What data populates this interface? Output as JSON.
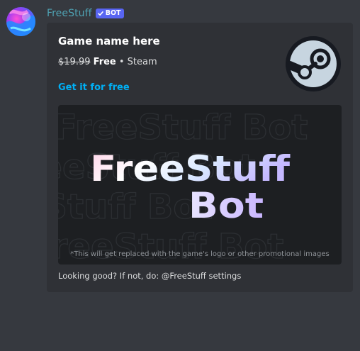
{
  "message": {
    "author": "FreeStuff",
    "bot_tag": "BOT"
  },
  "embed": {
    "title": "Game name here",
    "old_price": "$19.99",
    "price": "Free",
    "separator": " • ",
    "store": "Steam",
    "link_text": "Get it for free",
    "thumbnail_icon": "steam-logo-icon",
    "image": {
      "headline_line1": "FreeStuff",
      "headline_line2": "Bot",
      "background_text": "FreeStuff Bot",
      "caption": "*This will get replaced with the game's logo or other promotional images"
    },
    "footer_text": "Looking good? If not, do: @FreeStuff settings"
  },
  "colors": {
    "background": "#36393f",
    "embed_background": "#2f3136",
    "username": "#4fa3b4",
    "bot_tag": "#5865f2",
    "link": "#00aff4",
    "steam_circle": "#c7d5e0"
  }
}
